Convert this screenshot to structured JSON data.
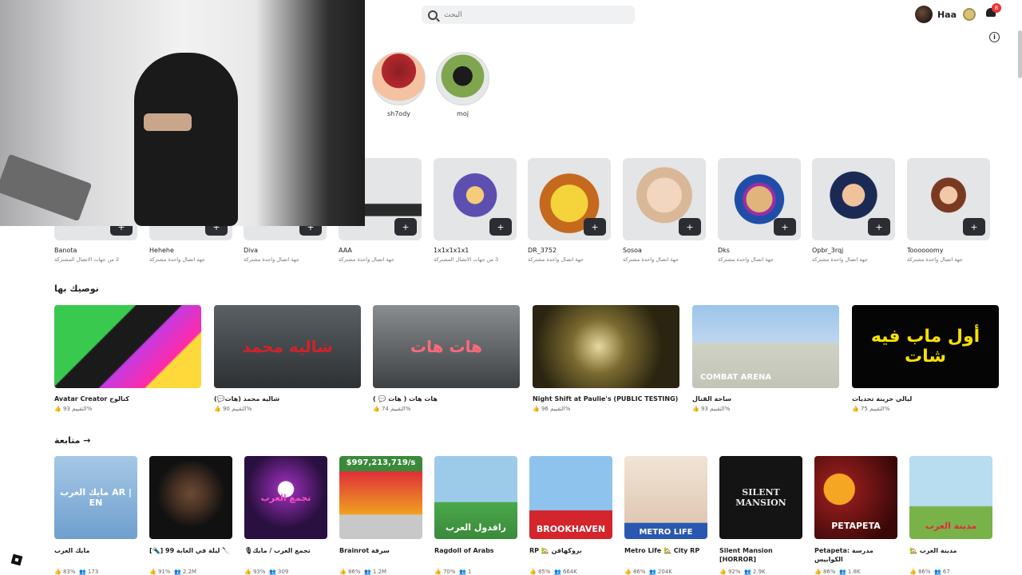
{
  "header": {
    "search_placeholder": "البحث",
    "username": "Haa",
    "notification_count": "8"
  },
  "top_friends": [
    {
      "name": "sh7ody",
      "color": "#b3272d"
    },
    {
      "name": "moj",
      "color": "#5e8a3c"
    }
  ],
  "connections": [
    {
      "name": "Banota",
      "sub": "2 من جهات الاتصال المشتركة"
    },
    {
      "name": "Hehehe",
      "sub": "جهة اتصال واحدة مشتركة"
    },
    {
      "name": "Diva",
      "sub": "جهة اتصال واحدة مشتركة"
    },
    {
      "name": "AAA",
      "sub": "جهة اتصال واحدة مشتركة"
    },
    {
      "name": "1x1x1x1x1",
      "sub": "3 من جهات الاتصال المشتركة"
    },
    {
      "name": "DR_3752",
      "sub": "جهة اتصال واحدة مشتركة"
    },
    {
      "name": "Sosoa",
      "sub": "جهة اتصال واحدة مشتركة"
    },
    {
      "name": "Dks",
      "sub": "جهة اتصال واحدة مشتركة"
    },
    {
      "name": "Opbr_3rqj",
      "sub": "جهة اتصال واحدة مشتركة"
    },
    {
      "name": "Toooooomy",
      "sub": "جهة اتصال واحدة مشتركة"
    }
  ],
  "recommended": {
    "title": "نوصيك بها",
    "items": [
      {
        "title": "Avatar Creator كتالوج",
        "rating": "التقييم 93%",
        "thumb_text": "",
        "bg": "#1bb04a",
        "fg": "#ffffff"
      },
      {
        "title": "شاليه محمد (هات💬)",
        "rating": "التقييم 90%",
        "thumb_text": "شاليه محمد",
        "bg": "#3d4246",
        "fg": "#d2232a"
      },
      {
        "title": "هات هات ( هات 💬 )",
        "rating": "التقييم 74%",
        "thumb_text": "هات هات",
        "bg": "#5a5d60",
        "fg": "#ff5a6a"
      },
      {
        "title": "Night Shift at Paulie's (PUBLIC TESTING)",
        "rating": "التقييم 96%",
        "thumb_text": "",
        "bg": "#3a3420",
        "fg": "#e7d27a"
      },
      {
        "title": "ساحة القتال",
        "rating": "التقييم 93%",
        "thumb_text": "COMBAT ARENA",
        "bg": "#6a8fb8",
        "fg": "#ffffff"
      },
      {
        "title": "ليالي حزينة تحديات",
        "rating": "التقييم 75%",
        "thumb_text": "أول ماب فيه شات",
        "bg": "#050505",
        "fg": "#f7e100"
      }
    ]
  },
  "continue": {
    "title": "متابعة",
    "items": [
      {
        "title": "مايك العرب",
        "rating": "83%",
        "players": "173",
        "thumb_text": "مايك العرب AR | EN",
        "bg": "#8fb6d8"
      },
      {
        "title": "[🔦] 99 ليلة في الغابة 🔪",
        "rating": "91%",
        "players": "2.2M",
        "thumb_text": "",
        "bg": "#111111"
      },
      {
        "title": "🎙تجمع العرب / مايك",
        "rating": "93%",
        "players": "309",
        "thumb_text": "تجمع العرب",
        "bg": "#1e1030"
      },
      {
        "title": "Brainrot سرقة",
        "rating": "86%",
        "players": "1.2M",
        "thumb_text": "$997,213,719/s",
        "bg": "#d8303a"
      },
      {
        "title": "Ragdoll of Arabs",
        "rating": "70%",
        "players": "1",
        "thumb_text": "راقدول العرب",
        "bg": "#8cc2e8"
      },
      {
        "title": "RP 🏡 بروكهافن",
        "rating": "85%",
        "players": "664K",
        "thumb_text": "BROOKHAVEN",
        "bg": "#5e9fd8"
      },
      {
        "title": "Metro Life 🏡 City RP",
        "rating": "86%",
        "players": "204K",
        "thumb_text": "METRO LIFE",
        "bg": "#e8d3c2"
      },
      {
        "title": "Silent Mansion [HORROR]",
        "rating": "92%",
        "players": "2.9K",
        "thumb_text": "SILENT MANSION",
        "bg": "#121212"
      },
      {
        "title": "Petapeta: مدرسة الكوابيس",
        "rating": "86%",
        "players": "1.8K",
        "thumb_text": "PETAPETA",
        "bg": "#6a1414"
      },
      {
        "title": "🏡 مدينة العرب",
        "rating": "86%",
        "players": "67",
        "thumb_text": "مدينة العرب",
        "bg": "#a8d2ea"
      }
    ]
  }
}
